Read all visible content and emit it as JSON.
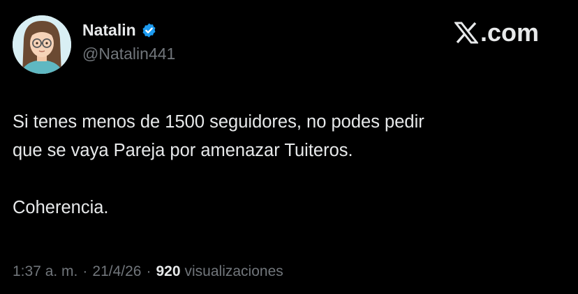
{
  "author": {
    "display_name": "Natalin",
    "handle": "@Natalin441",
    "verified": true
  },
  "brand": {
    "label": ".com",
    "icon": "x-logo-icon"
  },
  "tweet": {
    "lines": [
      "Si tenes menos de 1500 seguidores, no podes pedir",
      "que se vaya Pareja por amenazar Tuiteros.",
      "Coherencia."
    ]
  },
  "meta": {
    "time": "1:37 a. m.",
    "separator": "·",
    "date": "21/4/26",
    "views_count": "920",
    "views_label": "visualizaciones"
  },
  "colors": {
    "background": "#000000",
    "primary_text": "#e7e9ea",
    "secondary_text": "#71767b",
    "verified_badge": "#1d9bf0"
  }
}
